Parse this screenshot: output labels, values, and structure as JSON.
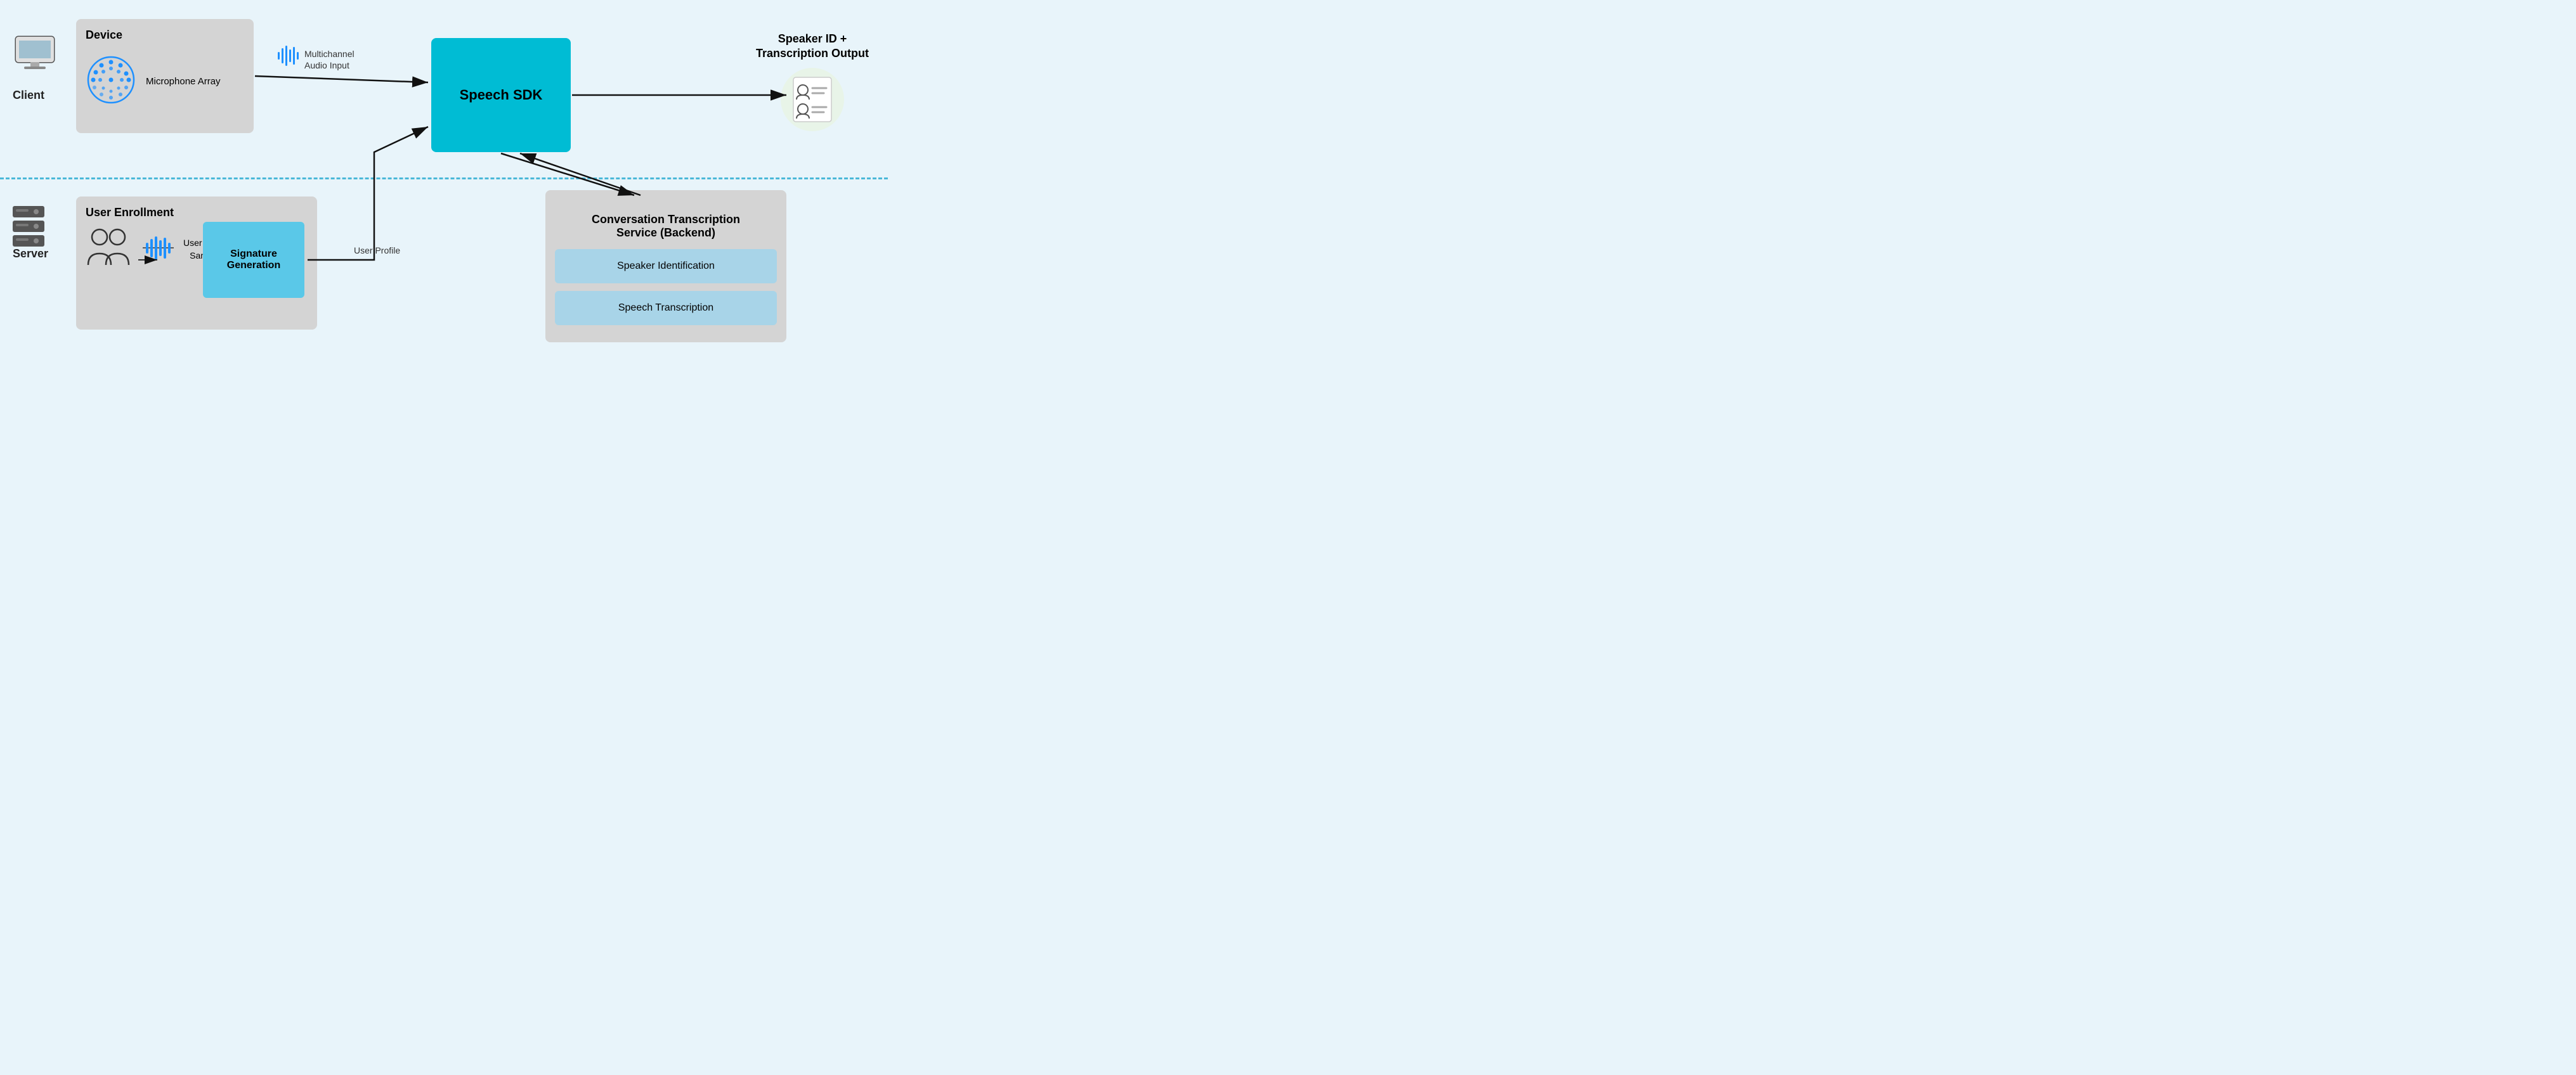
{
  "labels": {
    "client": "Client",
    "server": "Server",
    "device_title": "Device",
    "microphone_array": "Microphone Array",
    "multichannel_audio": "Multichannel\nAudio Input",
    "speech_sdk": "Speech SDK",
    "user_enrollment": "User Enrollment",
    "user_voice_sample": "User Voice\nSample",
    "signature_generation": "Signature\nGeneration",
    "user_profile": "User Profile",
    "cts_title": "Conversation Transcription\nService (Backend)",
    "speaker_identification": "Speaker Identification",
    "speech_transcription": "Speech Transcription",
    "output_title": "Speaker ID +\nTranscription Output"
  },
  "colors": {
    "accent_cyan": "#00bcd4",
    "light_cyan": "#5ac8e8",
    "box_bg": "#d4d4d4",
    "sub_box_bg": "#a8d4e8",
    "output_bg": "#e8f4e8",
    "divider": "#4ab8d8",
    "page_bg": "#e8f4fa",
    "arrow": "#111111",
    "blue_wave": "#1e90ff"
  }
}
